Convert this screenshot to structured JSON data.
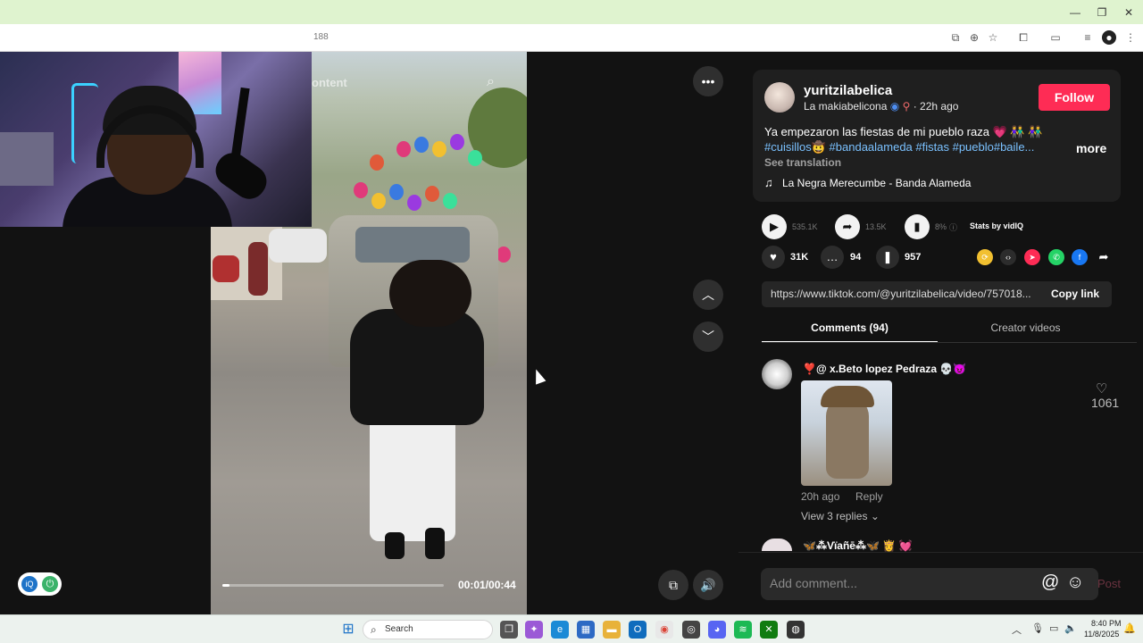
{
  "browser": {
    "url_fragment": "188",
    "toolbar_icons": [
      "cast-icon",
      "zoom-icon",
      "bookmark-star-icon",
      "extensions-icon",
      "media-icon",
      "reading-list-icon",
      "profile-icon",
      "menu-icon"
    ]
  },
  "video": {
    "search_overlay": "ontent",
    "time": "00:01/00:44",
    "progress": 0.023
  },
  "post": {
    "username": "yuritzilabelica",
    "nickname": "La makiabelicona",
    "time_ago": "· 22h ago",
    "follow_label": "Follow",
    "caption": "Ya empezaron las fiestas de mi pueblo raza 💗 👫 👫",
    "hashtags": "#cuisillos🤠 #bandaalameda #fistas #pueblo#baile...",
    "more_label": "more",
    "see_translation": "See translation",
    "music": "La Negra Merecumbe - Banda Alameda"
  },
  "stats": {
    "plays": "535.1K",
    "shares": "13.5K",
    "percent": "8%",
    "vidiq_label": "Stats by vidIQ"
  },
  "actions": {
    "likes": "31K",
    "comments": "94",
    "saves": "957"
  },
  "share_link": {
    "url": "https://www.tiktok.com/@yuritzilabelica/video/757018...",
    "copy_label": "Copy link"
  },
  "tabs": {
    "comments": "Comments (94)",
    "creator": "Creator videos"
  },
  "comments": [
    {
      "name": "❣️@ x.Beto lopez Pedraza 💀😈",
      "time": "20h ago",
      "reply_label": "Reply",
      "view_replies": "View 3 replies ⌄",
      "likes": "1061"
    },
    {
      "name": "🦋⁂Vïañē⁂🦋 👸 💓"
    }
  ],
  "comment_input": {
    "placeholder": "Add comment...",
    "post_label": "Post"
  },
  "taskbar": {
    "search_label": "Search",
    "time": "8:40 PM",
    "date": "11/8/2025"
  },
  "colors": {
    "follow": "#fe2c55",
    "hashtag": "#7ac1ff",
    "title_bar": "#dff3cf"
  }
}
